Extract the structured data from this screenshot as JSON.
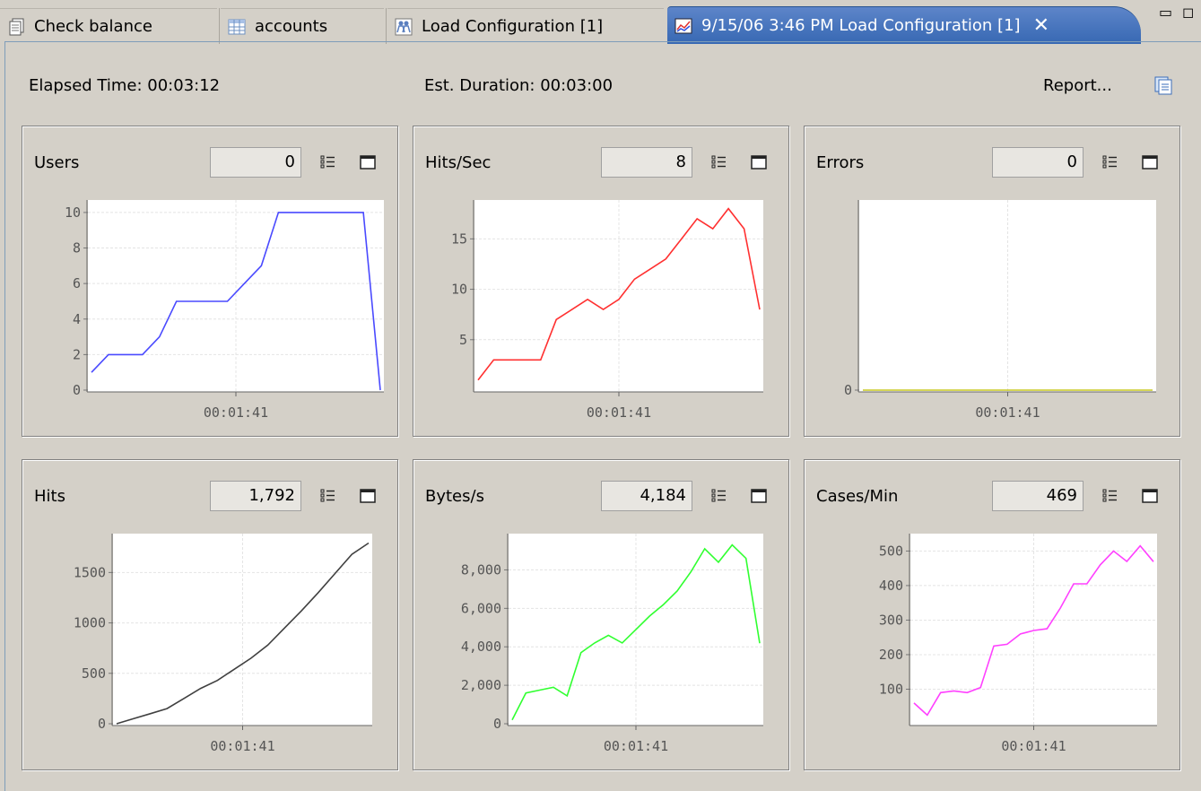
{
  "tabs": [
    {
      "label": "Check balance",
      "icon": "document-stack-icon"
    },
    {
      "label": "accounts",
      "icon": "table-icon"
    },
    {
      "label": "Load Configuration [1]",
      "icon": "users-icon"
    },
    {
      "label": "9/15/06 3:46 PM Load Configuration [1]",
      "icon": "chart-icon",
      "active": true
    }
  ],
  "header": {
    "elapsed": "Elapsed Time: 00:03:12",
    "est_duration": "Est. Duration: 00:03:00",
    "report": "Report..."
  },
  "panels": [
    {
      "title": "Users",
      "value": "0",
      "color": "#4a4aff"
    },
    {
      "title": "Hits/Sec",
      "value": "8",
      "color": "#ff3030"
    },
    {
      "title": "Errors",
      "value": "0",
      "color": "#c8c820"
    },
    {
      "title": "Hits",
      "value": "1,792",
      "color": "#404040"
    },
    {
      "title": "Bytes/s",
      "value": "4,184",
      "color": "#30ff30"
    },
    {
      "title": "Cases/Min",
      "value": "469",
      "color": "#ff40ff"
    }
  ],
  "chart_data": [
    {
      "type": "line",
      "title": "Users",
      "xlabel": "00:01:41",
      "ylim": [
        0,
        10.5
      ],
      "yticks": [
        0,
        2,
        4,
        6,
        8,
        10
      ],
      "x": [
        0,
        1,
        2,
        3,
        4,
        5,
        6,
        7,
        8,
        9,
        10,
        11,
        12,
        13,
        14,
        15,
        16,
        17
      ],
      "values": [
        1,
        2,
        2,
        2,
        3,
        5,
        5,
        5,
        5,
        6,
        7,
        10,
        10,
        10,
        10,
        10,
        10,
        0
      ]
    },
    {
      "type": "line",
      "title": "Hits/Sec",
      "xlabel": "00:01:41",
      "ylim": [
        0,
        18.5
      ],
      "yticks": [
        5,
        10,
        15
      ],
      "x": [
        0,
        1,
        2,
        3,
        4,
        5,
        6,
        7,
        8,
        9,
        10,
        11,
        12,
        13,
        14,
        15,
        16,
        17,
        18,
        19,
        20
      ],
      "values": [
        1,
        3,
        3,
        3,
        3,
        7,
        8,
        9,
        8,
        9,
        11,
        12,
        13,
        15,
        17,
        16,
        18,
        16,
        8
      ]
    },
    {
      "type": "line",
      "title": "Errors",
      "xlabel": "00:01:41",
      "ylim": [
        0,
        1
      ],
      "yticks": [
        0
      ],
      "values": [
        0,
        0
      ]
    },
    {
      "type": "line",
      "title": "Hits",
      "xlabel": "00:01:41",
      "ylim": [
        0,
        1850
      ],
      "yticks": [
        0,
        500,
        1000,
        1500
      ],
      "values": [
        0,
        50,
        100,
        150,
        250,
        350,
        430,
        540,
        650,
        780,
        950,
        1120,
        1300,
        1490,
        1680,
        1792
      ]
    },
    {
      "type": "line",
      "title": "Bytes/s",
      "xlabel": "00:01:41",
      "ylim": [
        0,
        9700
      ],
      "yticks": [
        0,
        2000,
        4000,
        6000,
        8000
      ],
      "ytick_labels": [
        "0",
        "2,000",
        "4,000",
        "6,000",
        "8,000"
      ],
      "values": [
        200,
        1600,
        1750,
        1900,
        1450,
        3700,
        4200,
        4600,
        4200,
        4900,
        5600,
        6200,
        6900,
        7900,
        9100,
        8400,
        9300,
        8600,
        4184
      ]
    },
    {
      "type": "line",
      "title": "Cases/Min",
      "xlabel": "00:01:41",
      "ylim": [
        0,
        540
      ],
      "yticks": [
        100,
        200,
        300,
        400,
        500
      ],
      "values": [
        60,
        25,
        90,
        95,
        90,
        105,
        225,
        230,
        260,
        270,
        275,
        335,
        405,
        405,
        460,
        500,
        470,
        515,
        469
      ]
    }
  ]
}
